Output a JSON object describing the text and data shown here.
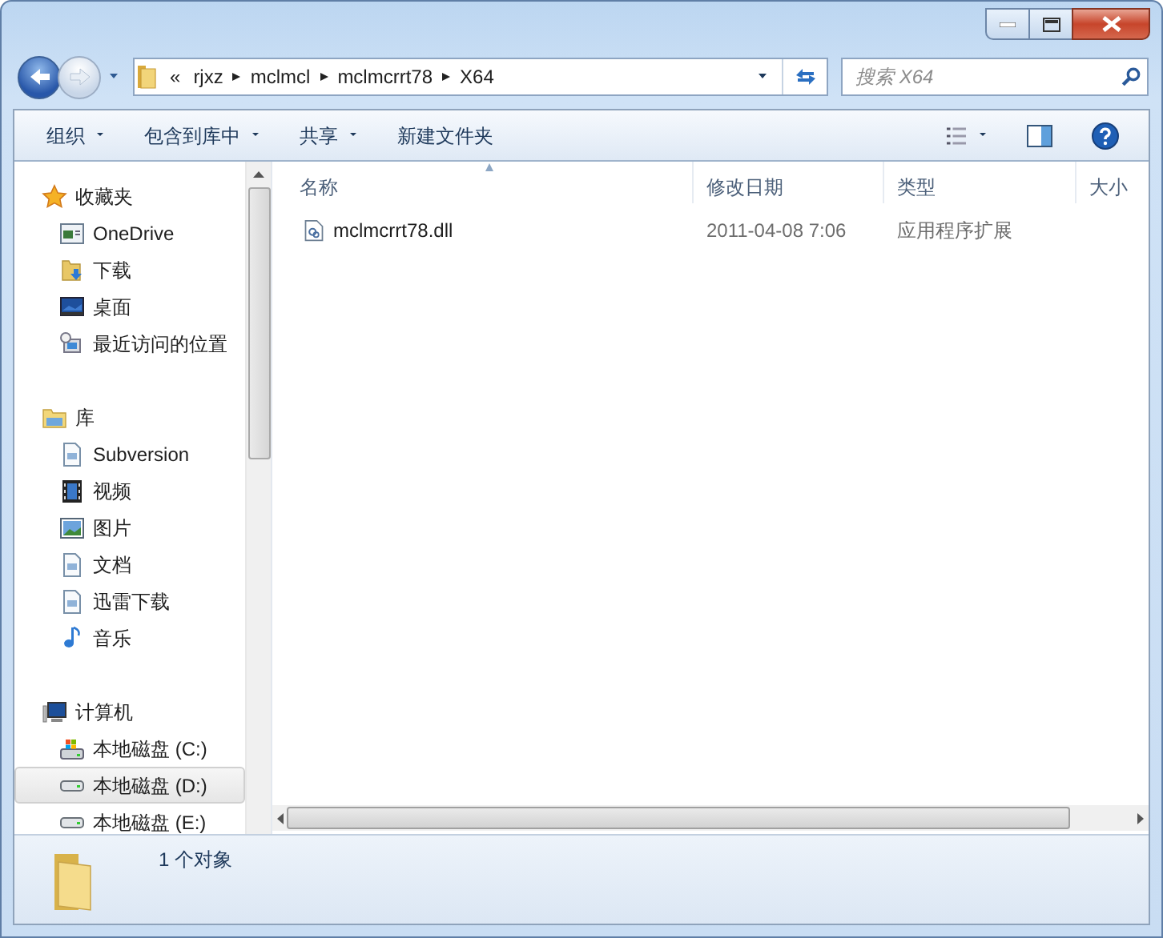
{
  "navigation": {
    "back_enabled": true,
    "forward_enabled": false
  },
  "address": {
    "breadcrumb": [
      "«",
      "rjxz",
      "mclmcl",
      "mclmcrrt78",
      "X64"
    ]
  },
  "search": {
    "placeholder": "搜索 X64"
  },
  "toolbar": [
    {
      "label": "组织",
      "dropdown": true
    },
    {
      "label": "包含到库中",
      "dropdown": true
    },
    {
      "label": "共享",
      "dropdown": true
    },
    {
      "label": "新建文件夹",
      "dropdown": false
    }
  ],
  "sidebar": {
    "groups": [
      {
        "label": "收藏夹",
        "kind": "favorites",
        "children": [
          {
            "label": "OneDrive",
            "kind": "cloud",
            "selected": false
          },
          {
            "label": "下载",
            "kind": "downloads",
            "selected": false
          },
          {
            "label": "桌面",
            "kind": "desktop",
            "selected": false
          },
          {
            "label": "最近访问的位置",
            "kind": "recent",
            "selected": false
          }
        ]
      },
      {
        "label": "库",
        "kind": "library",
        "children": [
          {
            "label": "Subversion",
            "kind": "document",
            "selected": false
          },
          {
            "label": "视频",
            "kind": "video",
            "selected": false
          },
          {
            "label": "图片",
            "kind": "picture",
            "selected": false
          },
          {
            "label": "文档",
            "kind": "document",
            "selected": false
          },
          {
            "label": "迅雷下载",
            "kind": "document",
            "selected": false
          },
          {
            "label": "音乐",
            "kind": "music",
            "selected": false
          }
        ]
      },
      {
        "label": "计算机",
        "kind": "computer",
        "children": [
          {
            "label": "本地磁盘 (C:)",
            "kind": "system-drive",
            "selected": false
          },
          {
            "label": "本地磁盘 (D:)",
            "kind": "drive",
            "selected": true
          },
          {
            "label": "本地磁盘 (E:)",
            "kind": "drive",
            "selected": false
          }
        ]
      }
    ]
  },
  "table": {
    "columns": [
      {
        "label": "名称",
        "sorted": true
      },
      {
        "label": "修改日期",
        "sorted": false
      },
      {
        "label": "类型",
        "sorted": false
      },
      {
        "label": "大小",
        "sorted": false
      }
    ],
    "rows": [
      {
        "name": "mclmcrrt78.dll",
        "modified": "2011-04-08 7:06",
        "type": "应用程序扩展"
      }
    ]
  },
  "status_bar": {
    "text": "1 个对象"
  }
}
